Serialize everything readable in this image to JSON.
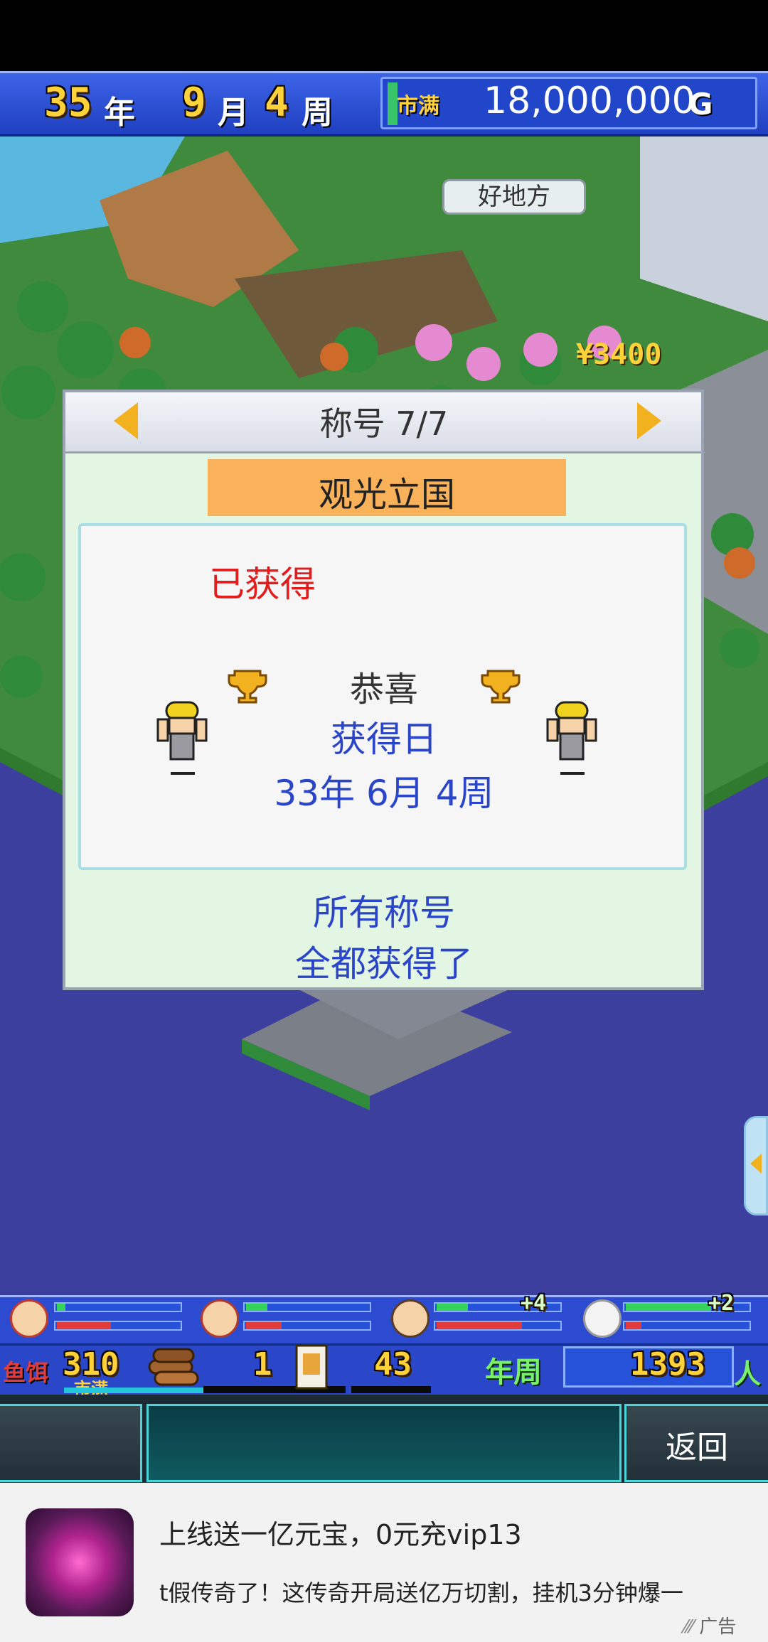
{
  "status": {
    "year_num": "35",
    "year_unit": "年",
    "month_num": "9",
    "month_unit": "月",
    "week_num": "4",
    "week_unit": "周",
    "city_tag": "市满",
    "money": "18,000,000",
    "money_unit": "G"
  },
  "map": {
    "place_label": "好地方",
    "price_tag": "¥3400"
  },
  "dialog": {
    "title": "称号 7/7",
    "banner": "观光立国",
    "status": "已获得",
    "congrats": "恭喜",
    "date_label": "获得日",
    "date_value": "33年 6月 4周",
    "footer_line1": "所有称号",
    "footer_line2": "全都获得了"
  },
  "hud": {
    "residents": [
      {
        "icon": "farmer-face-icon",
        "bonus": ""
      },
      {
        "icon": "monk-face-icon",
        "bonus": ""
      },
      {
        "icon": "boy-face-icon",
        "bonus": "+4"
      },
      {
        "icon": "elder-face-icon",
        "bonus": "+2"
      }
    ],
    "bait_label": "鱼饵",
    "bait_value": "310",
    "city_tag": "市满",
    "wood_value": "1",
    "card_value": "43",
    "period_label": "年周",
    "population": "1393",
    "population_unit": "人"
  },
  "nav": {
    "back_label": "返回"
  },
  "ad": {
    "title": "上线送一亿元宝，0元充vip13",
    "description": "t假传奇了！这传奇开局送亿万切割，挂机3分钟爆一",
    "label": "广告"
  },
  "colors": {
    "accent_blue": "#2b45c8",
    "obtained_red": "#e21d1d",
    "banner_orange": "#f9b25a",
    "gold": "#ffd23a"
  }
}
